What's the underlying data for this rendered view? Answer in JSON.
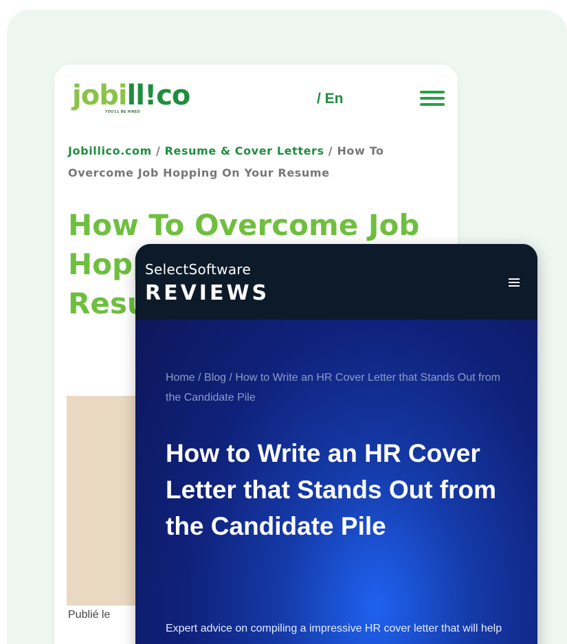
{
  "jobillico": {
    "logo": {
      "part1": "jobi",
      "part2": "ll",
      "part3": "!co",
      "tagline": "YOU'LL BE HIRED"
    },
    "lang": "/ En",
    "breadcrumb": {
      "home": "Jobillico.com",
      "sep1": " / ",
      "section": "Resume & Cover Letters",
      "sep2": " / ",
      "current": "How To Overcome Job Hopping On Your Resume"
    },
    "title": "How To Overcome Job Hopping On Your Resume",
    "published": "Publié le"
  },
  "selectsoftware": {
    "logo_top": "SelectSoftware",
    "logo_bottom": "REVIEWS",
    "breadcrumb": "Home / Blog / How to Write an HR Cover Letter that Stands Out from the Candidate Pile",
    "title": "How to Write an HR Cover Letter that Stands Out from the Candidate Pile",
    "description": "Expert advice on compiling a impressive HR cover letter that will help you land that PeopleOps role."
  },
  "colors": {
    "page_bg": "#eef6f1",
    "jobillico_green": "#1e8e3e",
    "jobillico_title": "#6fbf3f",
    "ss_header": "#0d1a2a",
    "ss_accent": "#1f62f0"
  }
}
